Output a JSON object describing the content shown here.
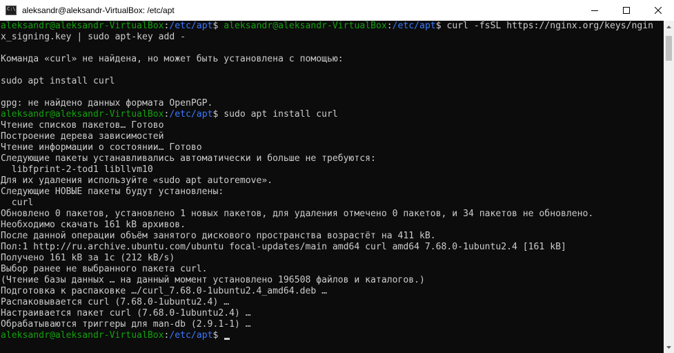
{
  "window": {
    "title": "aleksandr@aleksandr-VirtualBox: /etc/apt",
    "app_icon_text": "C:\\"
  },
  "prompt": {
    "user_host": "aleksandr@aleksandr-VirtualBox",
    "path": "/etc/apt",
    "symbol": "$"
  },
  "terminal": {
    "lines": [
      {
        "type": "prompt_double",
        "cmd": "curl -fsSL https://nginx.org/keys/ngin"
      },
      {
        "type": "text",
        "text": "x_signing.key | sudo apt-key add -"
      },
      {
        "type": "blank",
        "text": ""
      },
      {
        "type": "text",
        "text": "Команда «curl» не найдена, но может быть установлена с помощью:"
      },
      {
        "type": "blank",
        "text": ""
      },
      {
        "type": "text",
        "text": "sudo apt install curl"
      },
      {
        "type": "blank",
        "text": ""
      },
      {
        "type": "text",
        "text": "gpg: не найдено данных формата OpenPGP."
      },
      {
        "type": "prompt",
        "cmd": " sudo apt install curl"
      },
      {
        "type": "text",
        "text": "Чтение списков пакетов… Готово"
      },
      {
        "type": "text",
        "text": "Построение дерева зависимостей"
      },
      {
        "type": "text",
        "text": "Чтение информации о состоянии… Готово"
      },
      {
        "type": "text",
        "text": "Следующие пакеты устанавливались автоматически и больше не требуются:"
      },
      {
        "type": "text",
        "text": "  libfprint-2-tod1 libllvm10"
      },
      {
        "type": "text",
        "text": "Для их удаления используйте «sudo apt autoremove»."
      },
      {
        "type": "text",
        "text": "Следующие НОВЫЕ пакеты будут установлены:"
      },
      {
        "type": "text",
        "text": "  curl"
      },
      {
        "type": "text",
        "text": "Обновлено 0 пакетов, установлено 1 новых пакетов, для удаления отмечено 0 пакетов, и 34 пакетов не обновлено."
      },
      {
        "type": "text",
        "text": "Необходимо скачать 161 kB архивов."
      },
      {
        "type": "text",
        "text": "После данной операции объём занятого дискового пространства возрастёт на 411 kB."
      },
      {
        "type": "text",
        "text": "Пол:1 http://ru.archive.ubuntu.com/ubuntu focal-updates/main amd64 curl amd64 7.68.0-1ubuntu2.4 [161 kB]"
      },
      {
        "type": "text",
        "text": "Получено 161 kB за 1c (212 kB/s)"
      },
      {
        "type": "text",
        "text": "Выбор ранее не выбранного пакета curl."
      },
      {
        "type": "text",
        "text": "(Чтение базы данных … на данный момент установлено 196508 файлов и каталогов.)"
      },
      {
        "type": "text",
        "text": "Подготовка к распаковке …/curl_7.68.0-1ubuntu2.4_amd64.deb …"
      },
      {
        "type": "text",
        "text": "Распаковывается curl (7.68.0-1ubuntu2.4) …"
      },
      {
        "type": "text",
        "text": "Настраивается пакет curl (7.68.0-1ubuntu2.4) …"
      },
      {
        "type": "text",
        "text": "Обрабатываются триггеры для man-db (2.9.1-1) …"
      },
      {
        "type": "prompt_cursor",
        "cmd": " "
      }
    ]
  },
  "colors": {
    "background": "#0c0c0c",
    "text": "#cccccc",
    "user_host": "#13a10e",
    "path": "#3b78ff"
  }
}
